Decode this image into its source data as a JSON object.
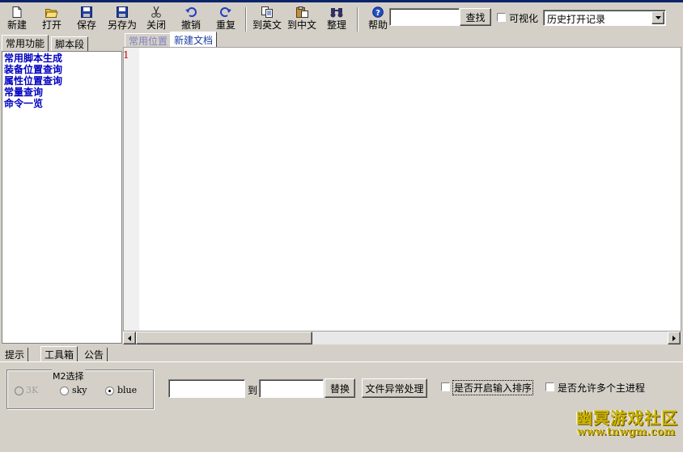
{
  "toolbar": {
    "buttons": [
      {
        "label": "新建",
        "icon": "new-file-icon"
      },
      {
        "label": "打开",
        "icon": "open-folder-icon"
      },
      {
        "label": "保存",
        "icon": "save-disk-icon"
      },
      {
        "label": "另存为",
        "icon": "save-as-disk-icon"
      },
      {
        "label": "关闭",
        "icon": "scissors-icon"
      },
      {
        "label": "撤销",
        "icon": "undo-arrow-icon"
      },
      {
        "label": "重复",
        "icon": "redo-arrow-icon"
      },
      {
        "label": "到英文",
        "icon": "copy-document-icon"
      },
      {
        "label": "到中文",
        "icon": "paste-clipboard-icon"
      },
      {
        "label": "整理",
        "icon": "binoculars-icon"
      },
      {
        "label": "帮助",
        "icon": "help-icon"
      }
    ],
    "search_value": "",
    "search_button": "查找",
    "visualize_label": "可视化",
    "history_select": "历史打开记录"
  },
  "left_tabs": [
    "常用功能",
    "脚本段"
  ],
  "left_list": [
    "常用脚本生成",
    "装备位置查询",
    "属性位置查询",
    "常量查询",
    "命令一览"
  ],
  "editor_tabs": [
    "常用位置",
    "新建文档"
  ],
  "editor": {
    "line_number": "1"
  },
  "bottom_tabs": [
    "提示",
    "工具箱",
    "公告"
  ],
  "toolbox": {
    "m2_group": "M2选择",
    "radios": [
      {
        "label": "3K",
        "selected": false,
        "disabled": true
      },
      {
        "label": "sky",
        "selected": false,
        "disabled": false
      },
      {
        "label": "blue",
        "selected": true,
        "disabled": false
      }
    ],
    "find_value": "",
    "to_label": "到",
    "replace_value": "",
    "replace_button": "替换",
    "file_error_button": "文件异常处理",
    "checkbox_sort": "是否开启输入排序",
    "checkbox_multi": "是否允许多个主进程"
  },
  "watermark": {
    "title": "幽冥游戏社区",
    "url": "www.tnwgm.com"
  }
}
